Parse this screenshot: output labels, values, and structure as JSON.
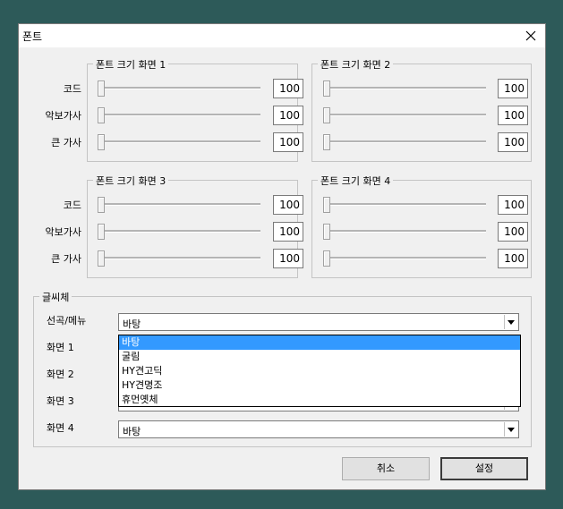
{
  "dialog": {
    "title": "폰트"
  },
  "size_groups": [
    {
      "legend": "폰트 크기 화면 1",
      "rows": [
        {
          "label": "코드",
          "value": "100",
          "level": 0
        },
        {
          "label": "악보가사",
          "value": "100",
          "level": 0
        },
        {
          "label": "큰 가사",
          "value": "100",
          "level": 0
        }
      ]
    },
    {
      "legend": "폰트 크기 화면 2",
      "rows": [
        {
          "label": "",
          "value": "100",
          "level": 0
        },
        {
          "label": "",
          "value": "100",
          "level": 0
        },
        {
          "label": "",
          "value": "100",
          "level": 0
        }
      ]
    },
    {
      "legend": "폰트 크기 화면 3",
      "rows": [
        {
          "label": "코드",
          "value": "100",
          "level": 0
        },
        {
          "label": "악보가사",
          "value": "100",
          "level": 0
        },
        {
          "label": "큰 가사",
          "value": "100",
          "level": 0
        }
      ]
    },
    {
      "legend": "폰트 크기 화면 4",
      "rows": [
        {
          "label": "",
          "value": "100",
          "level": 0
        },
        {
          "label": "",
          "value": "100",
          "level": 0
        },
        {
          "label": "",
          "value": "100",
          "level": 0
        }
      ]
    }
  ],
  "font_group": {
    "legend": "글씨체",
    "rows": [
      {
        "label": "선곡/메뉴",
        "value": "바탕"
      },
      {
        "label": "화면 1",
        "value": ""
      },
      {
        "label": "화면 2",
        "value": ""
      },
      {
        "label": "화면 3",
        "value": ""
      },
      {
        "label": "화면 4",
        "value": "바탕"
      }
    ],
    "dropdown_options": [
      "바탕",
      "굴림",
      "HY견고딕",
      "HY견명조",
      "휴먼옛체"
    ],
    "dropdown_selected": "바탕"
  },
  "buttons": {
    "cancel": "취소",
    "ok": "설정"
  },
  "colors": {
    "selection": "#3399ff",
    "background": "#2d5a59"
  }
}
